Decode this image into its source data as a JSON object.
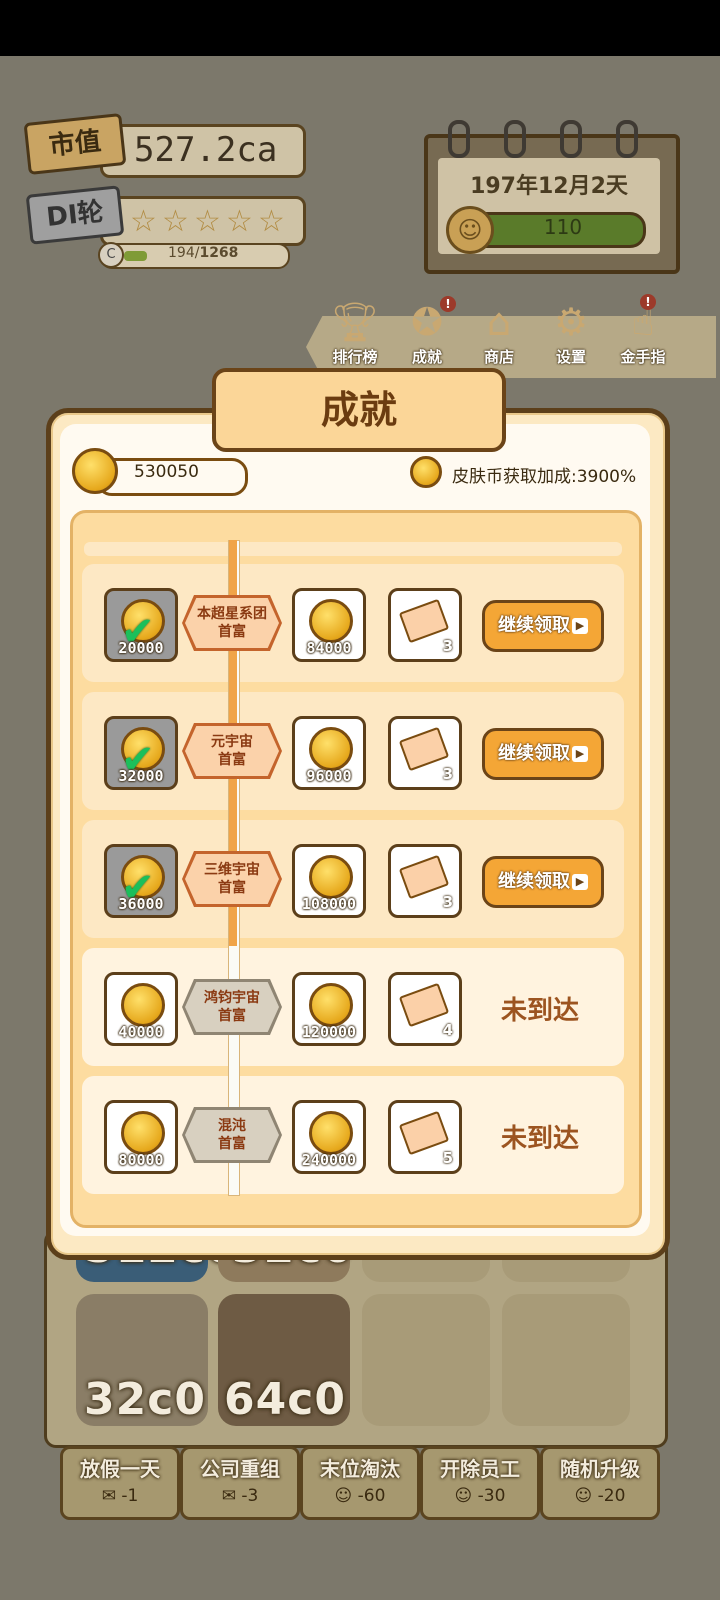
{
  "hud": {
    "market_cap_label": "市值",
    "market_cap_value": "527.2ca",
    "rank_label": "DI轮",
    "stars": [
      "☆",
      "☆",
      "☆",
      "☆",
      "☆"
    ],
    "progress_icon": "C",
    "progress_current": "194",
    "progress_total": "1268",
    "progress_fraction": 0.153
  },
  "calendar": {
    "date": "197年12月2天",
    "mood_value": "110",
    "mood_icon": "smiley-face-icon"
  },
  "menu": {
    "items": [
      {
        "label": "排行榜",
        "icon": "trophy-icon",
        "badge": false
      },
      {
        "label": "成就",
        "icon": "medal-icon",
        "badge": true
      },
      {
        "label": "商店",
        "icon": "shop-icon",
        "badge": false
      },
      {
        "label": "设置",
        "icon": "gear-icon",
        "badge": false
      },
      {
        "label": "金手指",
        "icon": "pointing-hand-icon",
        "badge": true
      }
    ],
    "badge_text": "!"
  },
  "modal": {
    "title": "成就",
    "coin_balance": "530050",
    "bonus_text": "皮肤币获取加成:3900%",
    "rows": [
      {
        "status": "done",
        "reward_coin": "20000",
        "milestone_line1": "本超星系团",
        "milestone_line2": "首富",
        "bonus_coin": "84000",
        "ticket_count": "3",
        "action": "继续领取"
      },
      {
        "status": "done",
        "reward_coin": "32000",
        "milestone_line1": "元宇宙",
        "milestone_line2": "首富",
        "bonus_coin": "96000",
        "ticket_count": "3",
        "action": "继续领取"
      },
      {
        "status": "done",
        "reward_coin": "36000",
        "milestone_line1": "三维宇宙",
        "milestone_line2": "首富",
        "bonus_coin": "108000",
        "ticket_count": "3",
        "action": "继续领取"
      },
      {
        "status": "pending",
        "reward_coin": "40000",
        "milestone_line1": "鸿钧宇宙",
        "milestone_line2": "首富",
        "bonus_coin": "120000",
        "ticket_count": "4",
        "action": "未到达"
      },
      {
        "status": "pending",
        "reward_coin": "80000",
        "milestone_line1": "混沌",
        "milestone_line2": "首富",
        "bonus_coin": "240000",
        "ticket_count": "5",
        "action": "未到达"
      }
    ],
    "play_icon": "▶"
  },
  "background": {
    "cards": [
      "512c0",
      "32c0",
      "32c0",
      "64c0"
    ],
    "actions": [
      {
        "label": "放假一天",
        "cost": "-1",
        "icon": "ticket-icon"
      },
      {
        "label": "公司重组",
        "cost": "-3",
        "icon": "ticket-icon"
      },
      {
        "label": "末位淘汰",
        "cost": "-60",
        "icon": "smiley-face-icon"
      },
      {
        "label": "开除员工",
        "cost": "-30",
        "icon": "smiley-face-icon"
      },
      {
        "label": "随机升级",
        "cost": "-20",
        "icon": "smiley-face-icon"
      }
    ]
  }
}
